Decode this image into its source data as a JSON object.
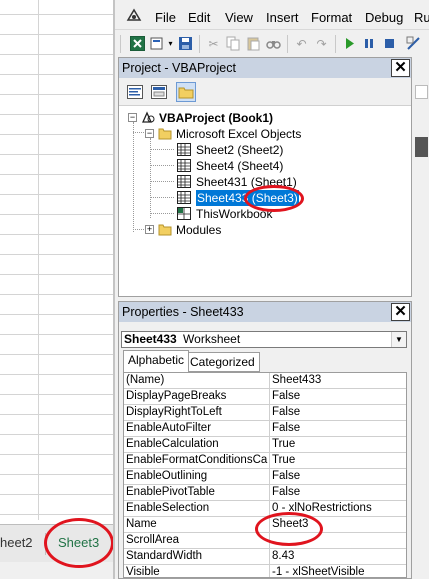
{
  "excel": {
    "tabs": [
      "heet2",
      "Sheet3"
    ]
  },
  "vbe": {
    "menu": [
      "File",
      "Edit",
      "View",
      "Insert",
      "Format",
      "Debug",
      "Ru"
    ]
  },
  "project": {
    "title": "Project - VBAProject",
    "close": "✕",
    "root": "VBAProject (Book1)",
    "folder_objects": "Microsoft Excel Objects",
    "sheets": [
      {
        "label": "Sheet2 (Sheet2)"
      },
      {
        "label": "Sheet4 (Sheet4)"
      },
      {
        "label": "Sheet431 (Sheet1)"
      }
    ],
    "selected_code": "Sheet433",
    "selected_name": "(Sheet3)",
    "workbook": "ThisWorkbook",
    "folder_modules": "Modules"
  },
  "properties": {
    "title": "Properties - Sheet433",
    "close": "✕",
    "object_name": "Sheet433",
    "object_type": "Worksheet",
    "tabs": [
      "Alphabetic",
      "Categorized"
    ],
    "rows": [
      {
        "name": "(Name)",
        "value": "Sheet433"
      },
      {
        "name": "DisplayPageBreaks",
        "value": "False"
      },
      {
        "name": "DisplayRightToLeft",
        "value": "False"
      },
      {
        "name": "EnableAutoFilter",
        "value": "False"
      },
      {
        "name": "EnableCalculation",
        "value": "True"
      },
      {
        "name": "EnableFormatConditionsCalcu",
        "value": "True"
      },
      {
        "name": "EnableOutlining",
        "value": "False"
      },
      {
        "name": "EnablePivotTable",
        "value": "False"
      },
      {
        "name": "EnableSelection",
        "value": "0 - xlNoRestrictions"
      },
      {
        "name": "Name",
        "value": "Sheet3"
      },
      {
        "name": "ScrollArea",
        "value": ""
      },
      {
        "name": "StandardWidth",
        "value": "8.43"
      },
      {
        "name": "Visible",
        "value": "-1 - xlSheetVisible"
      }
    ]
  },
  "colors": {
    "title_bar": "#c9d3e2",
    "selection": "#0078d7",
    "annotation": "#e0141e",
    "excel_green": "#217346"
  }
}
